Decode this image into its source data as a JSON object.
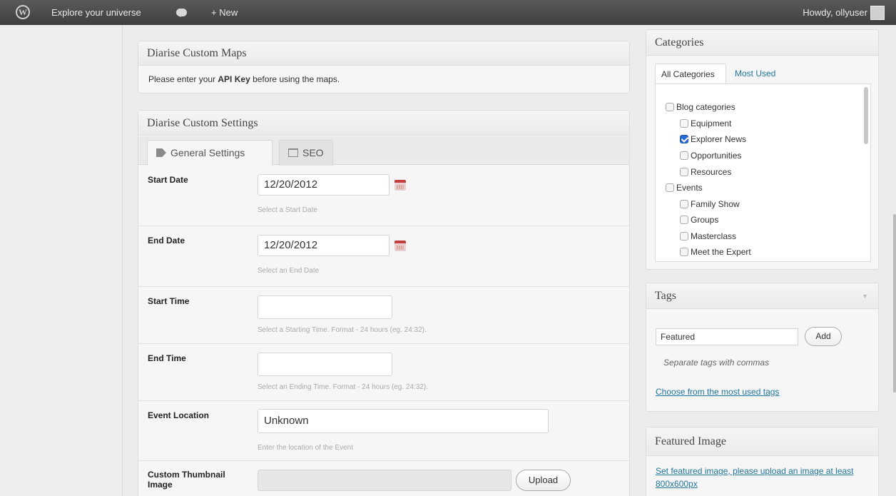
{
  "adminbar": {
    "wp_logo": "W",
    "site_name": "Explore your universe",
    "new_label": "+ New",
    "howdy": "Howdy, ollyuser"
  },
  "maps_box": {
    "title": "Diarise Custom Maps",
    "message_pre": "Please enter your ",
    "message_bold": "API Key",
    "message_post": " before using the maps."
  },
  "settings_box": {
    "title": "Diarise Custom Settings",
    "tabs": [
      {
        "label": "General Settings",
        "icon": "tag-icon"
      },
      {
        "label": "SEO",
        "icon": "sitemap-icon"
      }
    ],
    "fields": [
      {
        "label": "Start Date",
        "value": "12/20/2012",
        "hint": "Select a Start Date"
      },
      {
        "label": "End Date",
        "value": "12/20/2012",
        "hint": "Select an End Date"
      },
      {
        "label": "Start Time",
        "value": "",
        "hint": "Select a Starting Time. Format - 24 hours (eg. 24:32)."
      },
      {
        "label": "End Time",
        "value": "",
        "hint": "Select an Ending Time. Format - 24 hours (eg. 24:32)."
      },
      {
        "label": "Event Location",
        "value": "Unknown",
        "hint": "Enter the location of the Event"
      },
      {
        "label": "Custom Thumbnail Image",
        "value": "",
        "button": "Upload"
      }
    ]
  },
  "categories": {
    "title": "Categories",
    "tab_all": "All Categories",
    "tab_used": "Most Used",
    "items": [
      {
        "label": "Blog categories",
        "checked": false
      },
      {
        "label": "Equipment",
        "checked": false
      },
      {
        "label": "Explorer News",
        "checked": true
      },
      {
        "label": "Opportunities",
        "checked": false
      },
      {
        "label": "Resources",
        "checked": false
      },
      {
        "label": "Events",
        "checked": false
      },
      {
        "label": "Family Show",
        "checked": false
      },
      {
        "label": "Groups",
        "checked": false
      },
      {
        "label": "Masterclass",
        "checked": false
      },
      {
        "label": "Meet the Expert",
        "checked": false
      }
    ]
  },
  "tags": {
    "title": "Tags",
    "input_value": "Featured",
    "add_button": "Add",
    "hint": "Separate tags with commas",
    "link": "Choose from the most used tags"
  },
  "featured_image": {
    "title": "Featured Image",
    "link": "Set featured image, please upload an image at least 800x600px"
  }
}
